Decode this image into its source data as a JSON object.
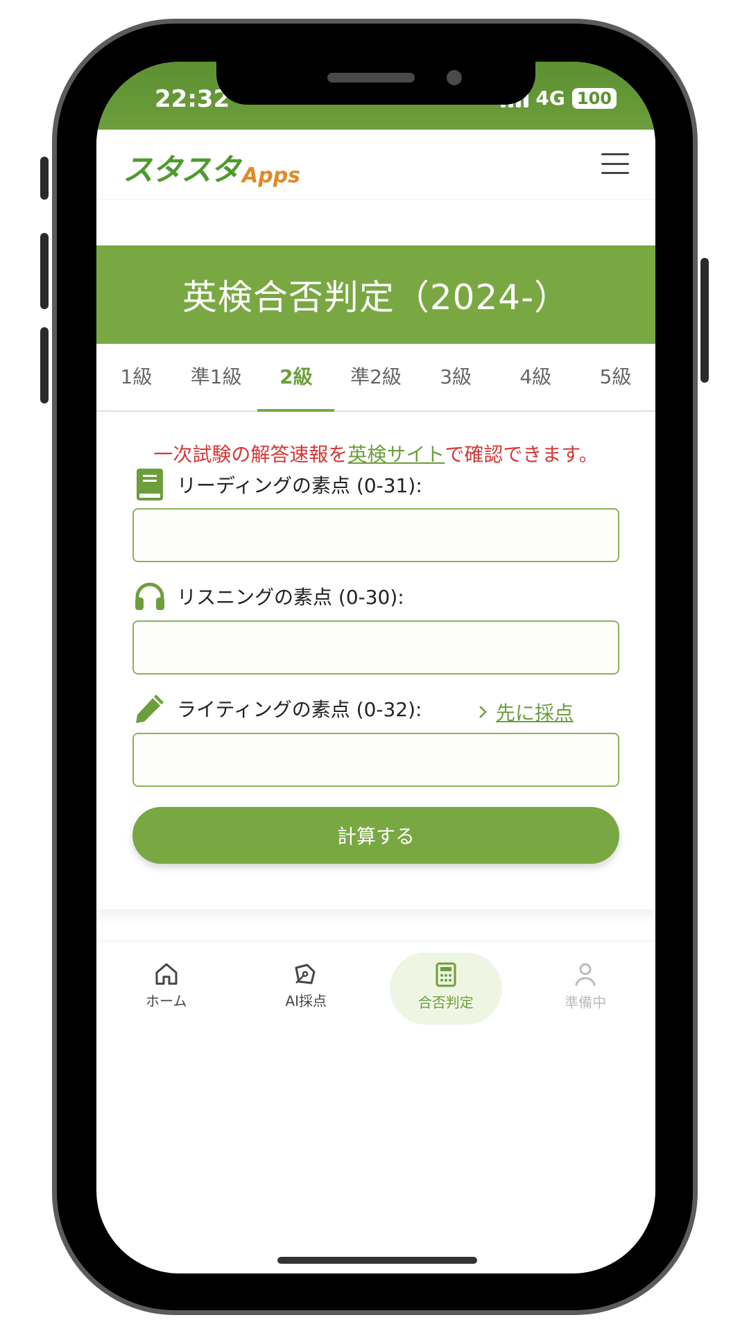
{
  "status": {
    "time": "22:32",
    "network": "4G",
    "battery": "100"
  },
  "header": {
    "logo_main": "スタスタ",
    "logo_sub": "Apps",
    "menu_icon": "hamburger-menu-icon"
  },
  "banner": {
    "title": "英検合否判定（2024-）"
  },
  "tabs": [
    {
      "label": "1級"
    },
    {
      "label": "準1級"
    },
    {
      "label": "2級"
    },
    {
      "label": "準2級"
    },
    {
      "label": "3級"
    },
    {
      "label": "4級"
    },
    {
      "label": "5級"
    }
  ],
  "active_tab": "2級",
  "notice": {
    "before": "一次試験の解答速報を",
    "link": "英検サイト",
    "after": "で確認できます。"
  },
  "form": {
    "reading_label": "リーディングの素点 (0-31):",
    "reading_value": "",
    "listening_label": "リスニングの素点 (0-30):",
    "listening_value": "",
    "writing_label": "ライティングの素点 (0-32):",
    "writing_value": "",
    "score_first_link": "先に採点",
    "calculate_button": "計算する"
  },
  "colors": {
    "primary": "#79a843",
    "notice": "#d43838",
    "status_bar": "#5c9032"
  },
  "bottom_nav": [
    {
      "label": "ホーム",
      "icon": "home-icon"
    },
    {
      "label": "AI採点",
      "icon": "pen-nib-icon"
    },
    {
      "label": "合否判定",
      "icon": "calculator-icon"
    },
    {
      "label": "準備中",
      "icon": "user-icon"
    }
  ]
}
